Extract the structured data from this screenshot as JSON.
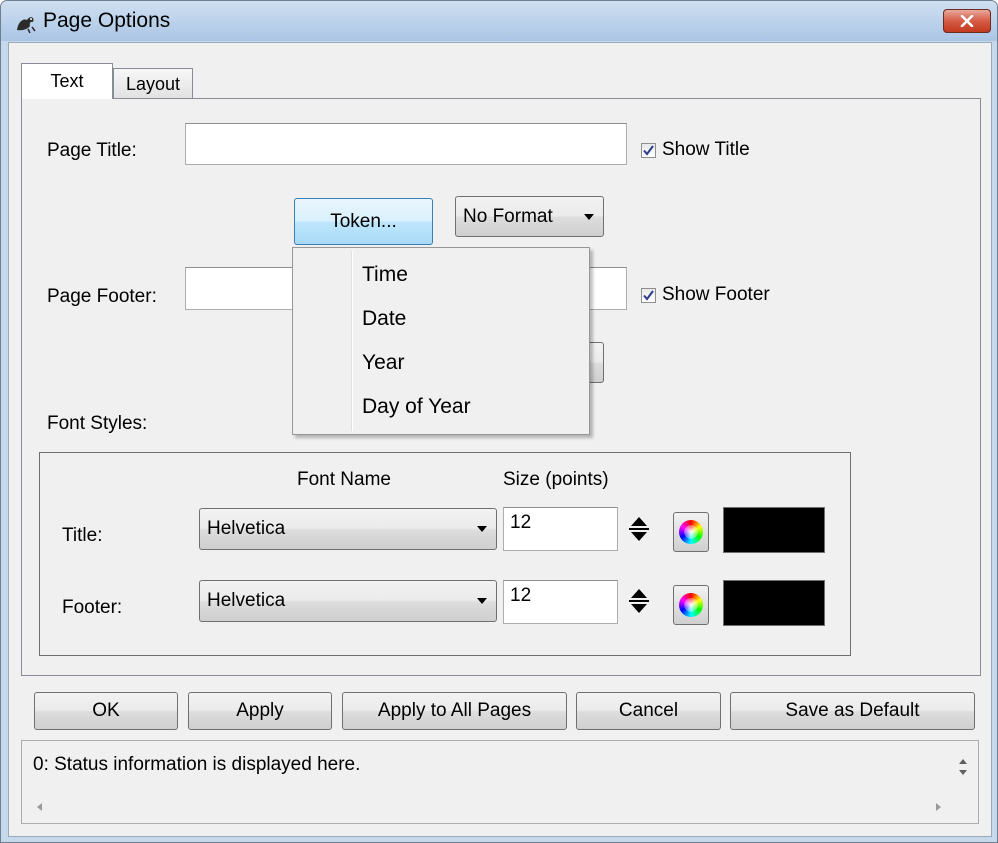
{
  "window": {
    "title": "Page Options",
    "app_icon": "squirrel-app-icon",
    "close_icon": "close-x-icon"
  },
  "tabs": [
    {
      "label": "Text",
      "active": true
    },
    {
      "label": "Layout",
      "active": false
    }
  ],
  "text_tab": {
    "page_title_label": "Page Title:",
    "page_title_value": "",
    "show_title_label": "Show Title",
    "show_title_checked": true,
    "token_button_label": "Token...",
    "format_value": "No Format",
    "page_footer_label": "Page Footer:",
    "page_footer_value": "",
    "show_footer_label": "Show Footer",
    "show_footer_checked": true,
    "font_styles_label": "Font Styles:",
    "font_name_header": "Font Name",
    "size_header": "Size (points)",
    "title_row_label": "Title:",
    "title_font": "Helvetica",
    "title_size": "12",
    "title_color": "#000000",
    "footer_row_label": "Footer:",
    "footer_font": "Helvetica",
    "footer_size": "12",
    "footer_color": "#000000"
  },
  "token_menu": {
    "items": [
      "Time",
      "Date",
      "Year",
      "Day of Year"
    ]
  },
  "buttons": {
    "ok": "OK",
    "apply": "Apply",
    "apply_all": "Apply to All Pages",
    "cancel": "Cancel",
    "save_default": "Save as Default"
  },
  "status": {
    "text": "0: Status information is displayed here."
  }
}
